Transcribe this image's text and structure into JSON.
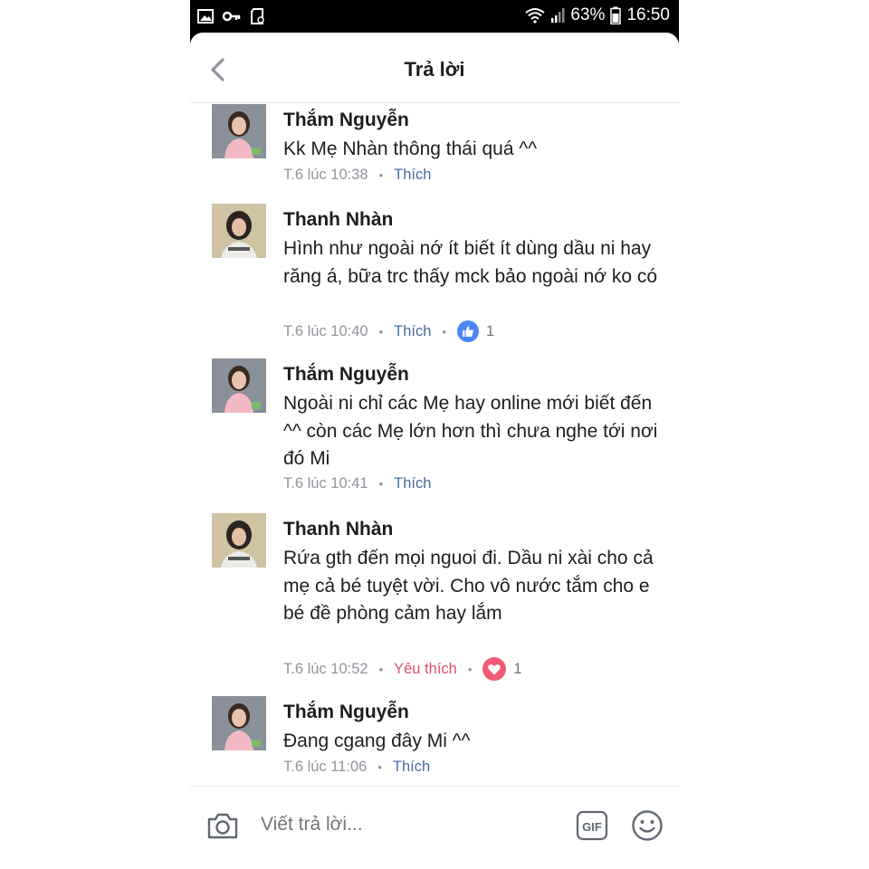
{
  "status_bar": {
    "battery": "63%",
    "time": "16:50",
    "icons": [
      "image-icon",
      "key-icon",
      "sd-card-icon",
      "wifi-icon",
      "signal-icon",
      "battery-icon"
    ]
  },
  "header": {
    "title": "Trả lời",
    "back_icon": "chevron-left-icon"
  },
  "comments": [
    {
      "author": "Thắm Nguyễn",
      "text": "Kk Mẹ Nhàn thông thái quá ^^",
      "time": "T.6 lúc 10:38",
      "action": "Thích",
      "reaction": null,
      "count": null
    },
    {
      "author": "Thanh Nhàn",
      "text": "Hình như ngoài nớ ít biết ít dùng dầu ni hay răng á, bữa trc thấy mck bảo ngoài nớ ko có",
      "time": "T.6 lúc 10:40",
      "action": "Thích",
      "reaction": "like",
      "count": "1"
    },
    {
      "author": "Thắm Nguyễn",
      "text": "Ngoài ni chỉ các Mẹ hay online mới biết đến ^^ còn các Mẹ lớn hơn thì chưa nghe tới nơi đó Mi",
      "time": "T.6 lúc 10:41",
      "action": "Thích",
      "reaction": null,
      "count": null
    },
    {
      "author": "Thanh Nhàn",
      "text": "Rứa gth đến mọi nguoi đi. Dầu ni xài cho cả mẹ cả bé tuyệt vời. Cho vô nước tắm cho e bé đề phòng cảm hay lắm",
      "time": "T.6 lúc 10:52",
      "action": "Yêu thích",
      "reaction": "love",
      "count": "1"
    },
    {
      "author": "Thắm Nguyễn",
      "text": "Đang cgang đây Mi ^^",
      "time": "T.6 lúc 11:06",
      "action": "Thích",
      "reaction": null,
      "count": null
    }
  ],
  "composer": {
    "placeholder": "Viết trả lời...",
    "camera_icon": "camera-icon",
    "gif_label": "GIF",
    "emoji_icon": "smiley-icon"
  },
  "colors": {
    "like_blue": "#4b6aa0",
    "love_red": "#e14f6a",
    "like_badge": "#4b86f5",
    "meta_gray": "#90949c"
  }
}
